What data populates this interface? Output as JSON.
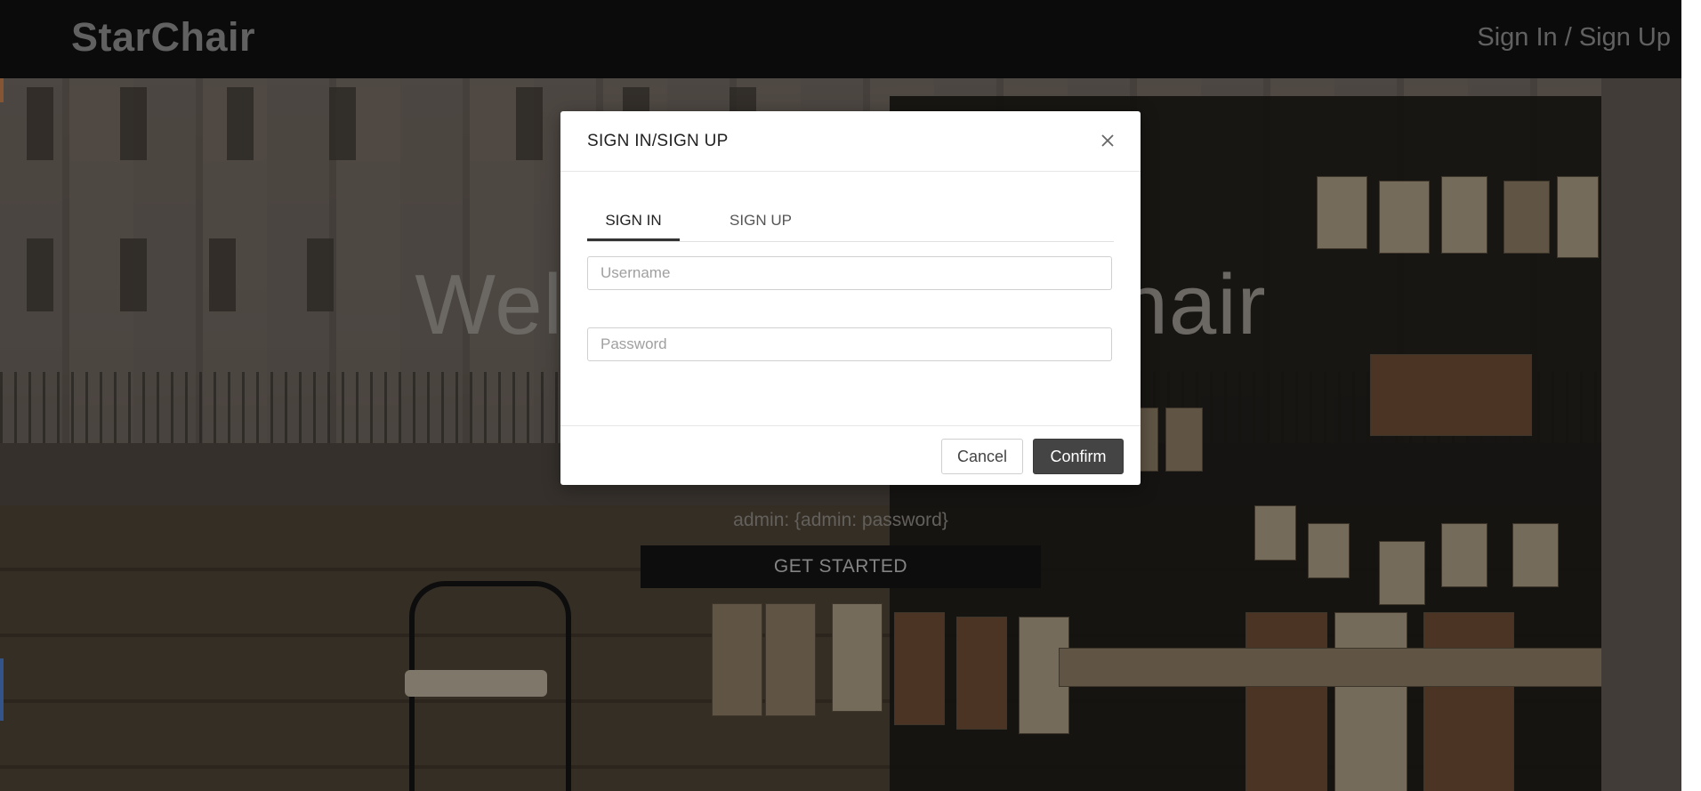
{
  "navbar": {
    "brand": "StarChair",
    "auth_link": "Sign In / Sign Up"
  },
  "hero": {
    "title": "Welcome to StarChair",
    "credentials_hint": "admin: {admin: password}",
    "cta_label": "GET STARTED"
  },
  "modal": {
    "title": "SIGN IN/SIGN UP",
    "close_icon": "close-icon",
    "tabs": [
      {
        "label": "SIGN IN",
        "active": true
      },
      {
        "label": "SIGN UP",
        "active": false
      }
    ],
    "username": {
      "value": "",
      "placeholder": "Username"
    },
    "password": {
      "value": "",
      "placeholder": "Password"
    },
    "cancel_label": "Cancel",
    "confirm_label": "Confirm"
  },
  "colors": {
    "navbar_bg": "#111111",
    "confirm_bg": "#444444",
    "cta_bg": "#131313"
  }
}
